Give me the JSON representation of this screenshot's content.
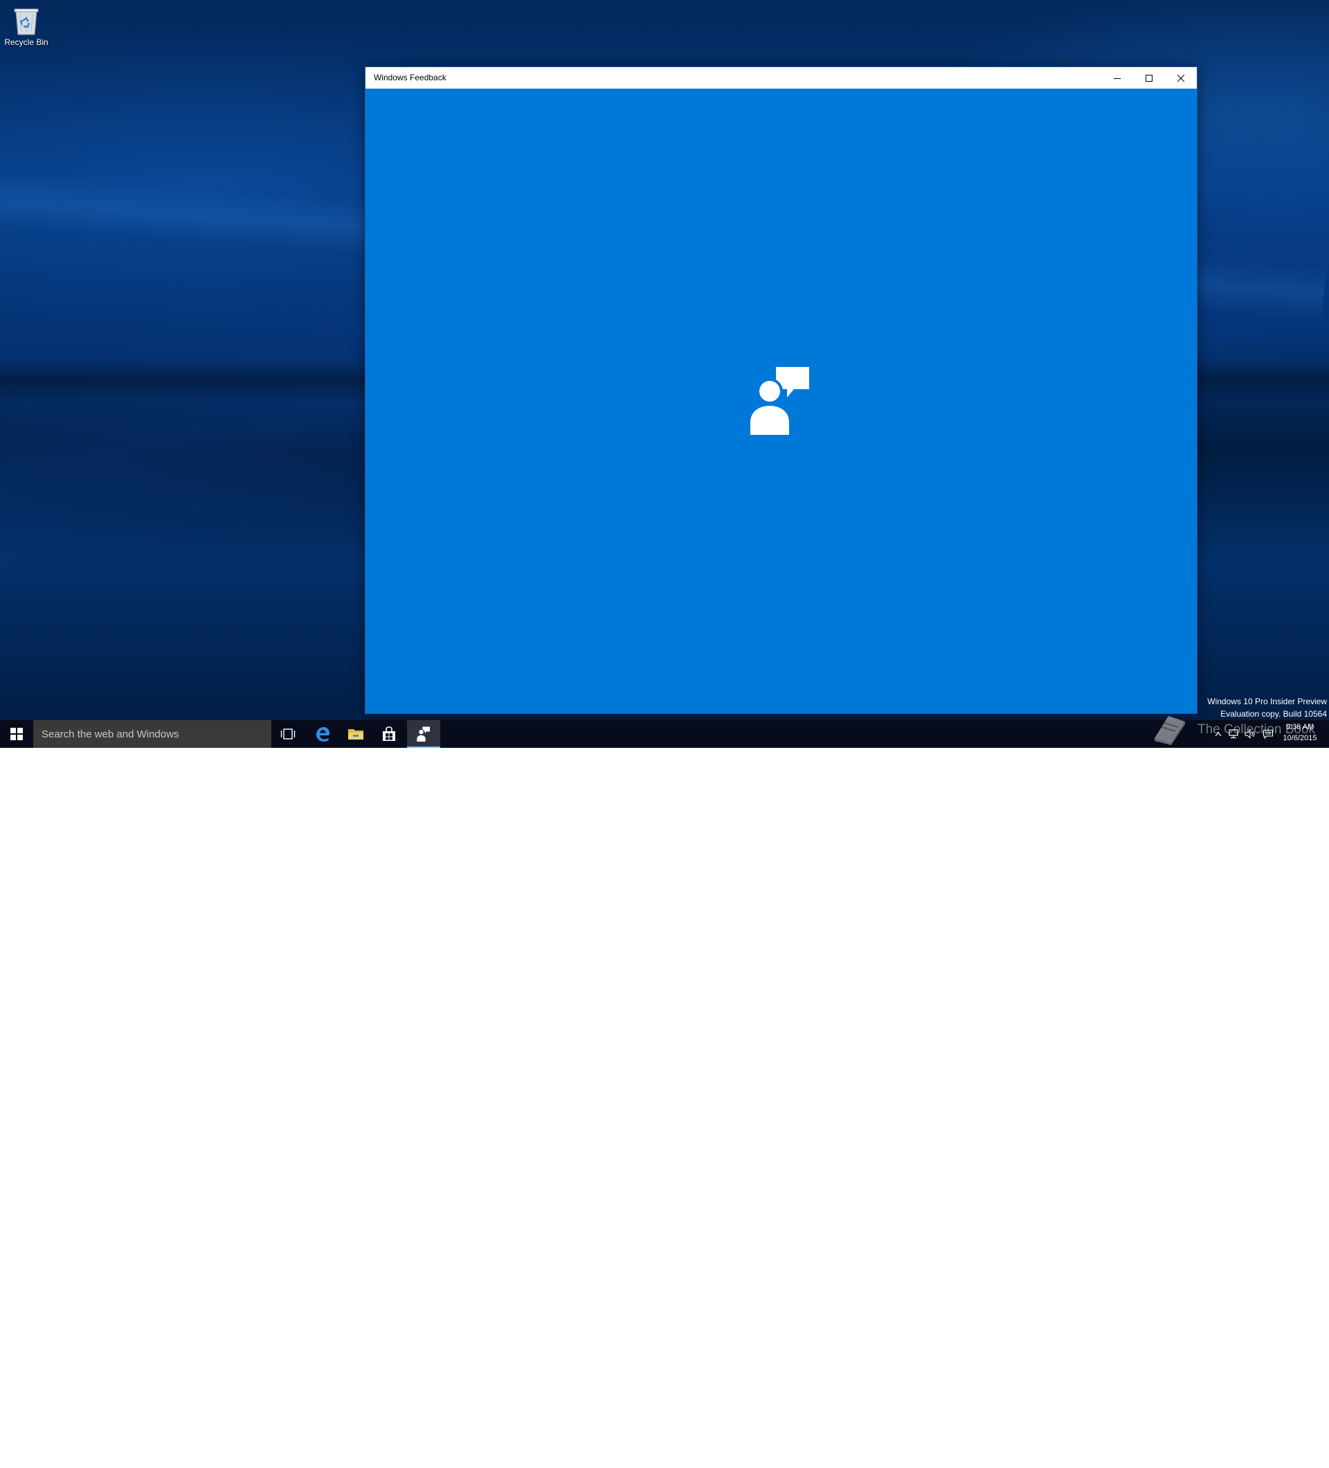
{
  "desktop": {
    "icons": [
      {
        "label": "Recycle Bin",
        "icon": "recycle-bin-icon"
      }
    ]
  },
  "window": {
    "title": "Windows Feedback",
    "controls": {
      "minimize": "minimize-icon",
      "maximize": "maximize-icon",
      "close": "close-icon"
    },
    "splash_icon": "feedback-person-speech-icon",
    "splash_color": "#0078d7",
    "title_bar_color": "#ffffff"
  },
  "watermark": {
    "edition": "Windows 10 Pro Insider Preview",
    "build": "Evaluation copy. Build 10564"
  },
  "overlay_logo": {
    "text": "The Collection Book",
    "icon": "book-icon"
  },
  "taskbar": {
    "start_icon": "windows-logo-icon",
    "search_placeholder": "Search the web and Windows",
    "apps": [
      {
        "name": "Task View",
        "icon": "task-view-icon"
      },
      {
        "name": "Microsoft Edge",
        "icon": "edge-icon"
      },
      {
        "name": "File Explorer",
        "icon": "folder-icon"
      },
      {
        "name": "Store",
        "icon": "store-icon"
      },
      {
        "name": "Windows Feedback",
        "icon": "feedback-icon",
        "active": true
      }
    ],
    "accent_color": "#76b9ed",
    "tray": {
      "icons": [
        "chevron-up-icon",
        "network-icon",
        "volume-icon",
        "action-center-icon"
      ],
      "time": "9:38 AM",
      "date": "10/6/2015"
    }
  }
}
